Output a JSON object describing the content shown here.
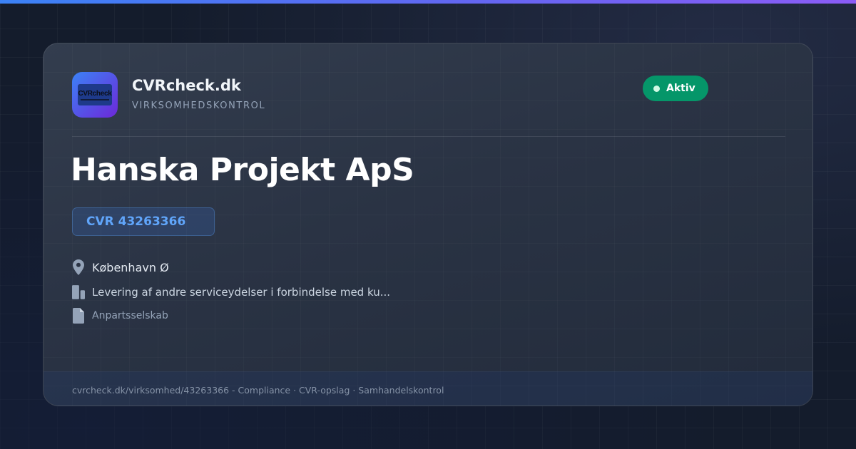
{
  "brand": {
    "logo_text": "CVRcheck",
    "name": "CVRcheck.dk",
    "tagline": "VIRKSOMHEDSKONTROL"
  },
  "status": {
    "label": "Aktiv",
    "color": "#059669"
  },
  "company": {
    "name": "Hanska Projekt ApS",
    "cvr": "CVR 43263366"
  },
  "details": {
    "city": {
      "icon": "location-pin-icon",
      "text": "København Ø"
    },
    "industry": {
      "icon": "building-icon",
      "text": "Levering af andre serviceydelser i forbindelse med ku..."
    },
    "company_form": {
      "icon": "document-icon",
      "text": "Anpartsselskab"
    }
  },
  "footer": {
    "text": "cvrcheck.dk/virksomhed/43263366 - Compliance · CVR-opslag · Samhandelskontrol"
  },
  "colors": {
    "accent": "#3b82f6",
    "accent_purple": "#8b5cf6",
    "cvr_text": "#60a5fa",
    "background": "#141c2c"
  }
}
